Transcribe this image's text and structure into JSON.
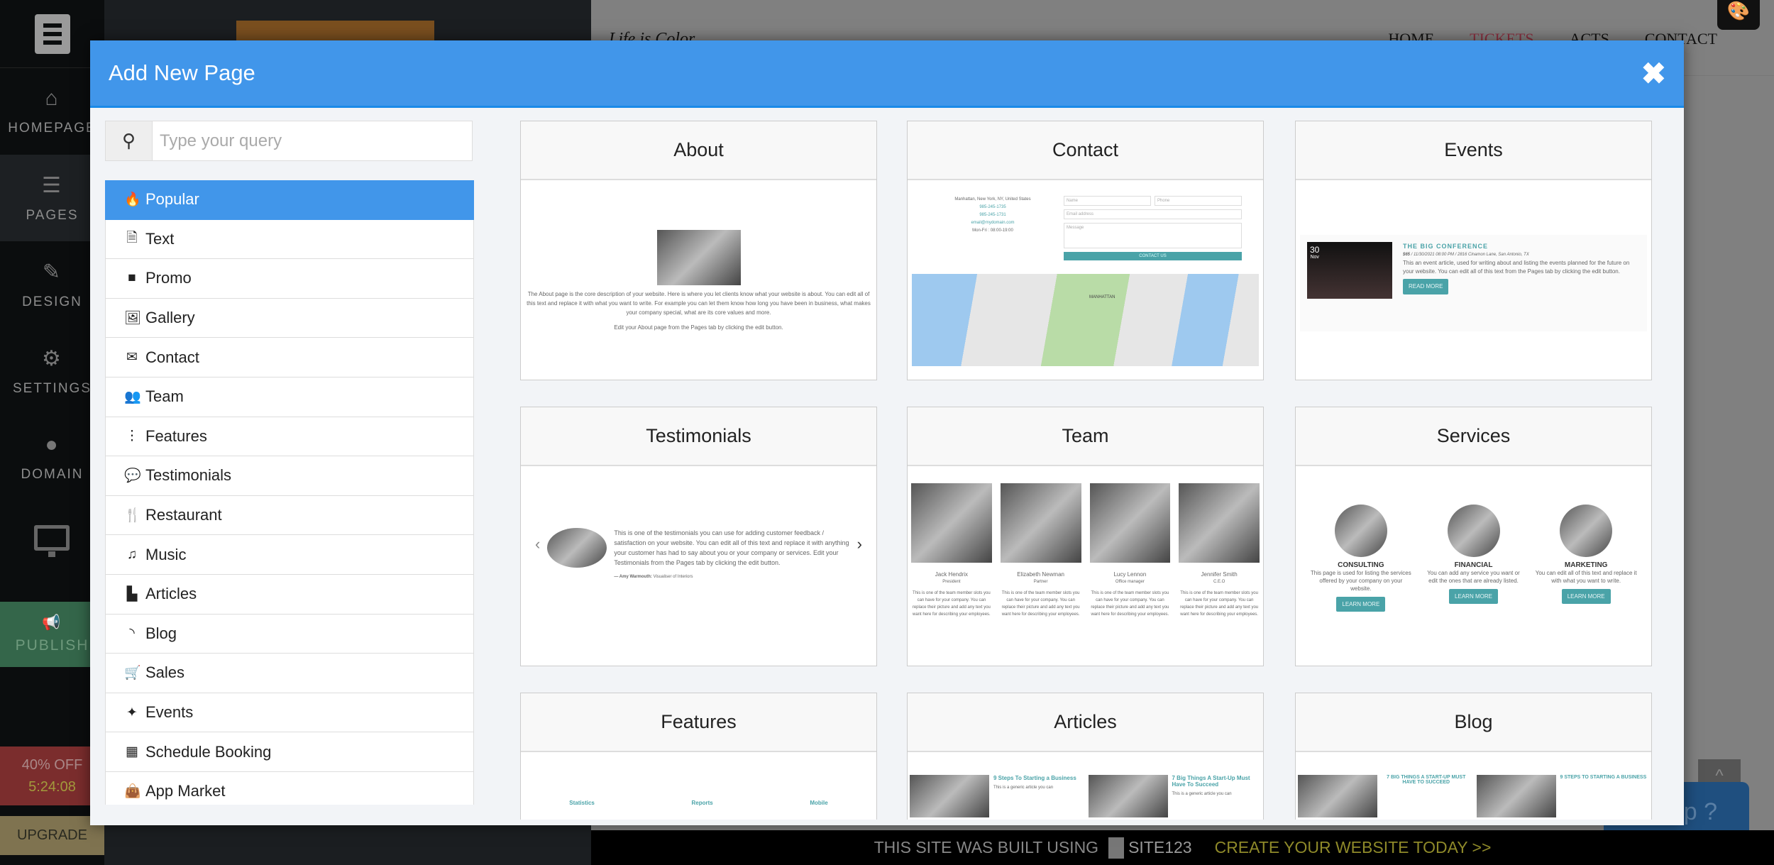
{
  "sidebar": {
    "items": [
      {
        "label": "HOMEPAGE",
        "icon": "home-icon"
      },
      {
        "label": "PAGES",
        "icon": "pages-icon"
      },
      {
        "label": "DESIGN",
        "icon": "brush-icon"
      },
      {
        "label": "SETTINGS",
        "icon": "gear-icon"
      },
      {
        "label": "DOMAIN",
        "icon": "globe-icon"
      }
    ],
    "publish": "PUBLISH",
    "offer": "40% OFF",
    "countdown": "5:24:08",
    "upgrade": "UPGRADE"
  },
  "site": {
    "brand": "Life is Color",
    "menu": [
      "HOME",
      "TICKETS",
      "ACTS",
      "CONTACT"
    ],
    "help": "Help ?",
    "footer": {
      "text": "THIS SITE WAS BUILT USING",
      "logo": "SITE123",
      "cta": "CREATE YOUR WEBSITE TODAY >>"
    }
  },
  "modal": {
    "title": "Add New Page",
    "close": "✖",
    "search_placeholder": "Type your query",
    "categories": [
      {
        "label": "Popular",
        "icon": "fire-icon"
      },
      {
        "label": "Text",
        "icon": "file-text-icon"
      },
      {
        "label": "Promo",
        "icon": "square-icon"
      },
      {
        "label": "Gallery",
        "icon": "image-icon"
      },
      {
        "label": "Contact",
        "icon": "envelope-icon"
      },
      {
        "label": "Team",
        "icon": "users-icon"
      },
      {
        "label": "Features",
        "icon": "ellipsis-icon"
      },
      {
        "label": "Testimonials",
        "icon": "comments-icon"
      },
      {
        "label": "Restaurant",
        "icon": "cutlery-icon"
      },
      {
        "label": "Music",
        "icon": "music-icon"
      },
      {
        "label": "Articles",
        "icon": "file-icon"
      },
      {
        "label": "Blog",
        "icon": "rss-icon"
      },
      {
        "label": "Sales",
        "icon": "cart-icon"
      },
      {
        "label": "Events",
        "icon": "ticket-icon"
      },
      {
        "label": "Schedule Booking",
        "icon": "calendar-icon"
      },
      {
        "label": "App Market",
        "icon": "bag-icon"
      }
    ],
    "cards": [
      "About",
      "Contact",
      "Events",
      "Testimonials",
      "Team",
      "Services",
      "Features",
      "Articles",
      "Blog"
    ]
  },
  "previews": {
    "about": {
      "text": "The About page is the core description of your website. Here is where you let clients know what your website is about. You can edit all of this text and replace it with what you want to write. For example you can let them know how long you have been in business, what makes your company special, what are its core values and more.",
      "edit": "Edit your About page from the Pages tab by clicking the edit button."
    },
    "contact": {
      "address": "Manhattan, New York, NY, United States",
      "phone": "985-245-1735",
      "fax": "985-245-1731",
      "email": "email@mydomain.com",
      "hours": "Mon-Fri : 08:00-19:00",
      "name": "Name",
      "phone_ph": "Phone",
      "email_ph": "Email address",
      "message": "Message",
      "button": "CONTACT US",
      "map_label": "MANHATTAN"
    },
    "events": {
      "day": "30",
      "month": "Nov",
      "title": "THE BIG CONFERENCE",
      "price": "$65",
      "date": "11/30/2021 08:00 PM",
      "place": "2816 Cinamon Lane, San Antonio, TX",
      "text": "This an event article, used for writing about and listing the events planned for the future on your website. You can edit all of this text from the Pages tab by clicking the edit button.",
      "button": "READ MORE"
    },
    "testimonials": {
      "text": "This is one of the testimonials you can use for adding customer feedback / satisfaction on your website. You can edit all of this text and replace it with anything your customer has had to say about you or your company or services. Edit your Testimonials from the Pages tab by clicking the edit button.",
      "author": "— Amy Warmouth:",
      "role": "Visualiser of Interiors"
    },
    "team": {
      "members": [
        {
          "name": "Jack Hendrix",
          "role": "President"
        },
        {
          "name": "Elizabeth Newman",
          "role": "Partner"
        },
        {
          "name": "Lucy Lennon",
          "role": "Office manager"
        },
        {
          "name": "Jennifer Smith",
          "role": "C.E.O"
        }
      ],
      "text": "This is one of the team member slots you can have for your company. You can replace their picture and add any text you want here for describing your employees."
    },
    "services": {
      "items": [
        {
          "title": "CONSULTING",
          "text": "This page is used for listing the services offered by your company on your website."
        },
        {
          "title": "FINANCIAL",
          "text": "You can add any service you want or edit the ones that are already listed."
        },
        {
          "title": "MARKETING",
          "text": "You can edit all of this text and replace it with what you want to write."
        }
      ],
      "button": "LEARN MORE"
    },
    "features": {
      "items": [
        "Statistics",
        "Reports",
        "Mobile"
      ]
    },
    "articles": {
      "items": [
        "9 Steps To Starting a Business",
        "7 Big Things A Start-Up Must Have To Succeed"
      ],
      "text": "This is a generic article you can"
    },
    "blog": {
      "items": [
        "7 BIG THINGS A START-UP MUST HAVE TO SUCCEED",
        "9 STEPS TO STARTING A BUSINESS"
      ]
    }
  },
  "colors": {
    "accent": "#4196ea",
    "teal": "#4aa3a8",
    "publish": "#34664a",
    "offer": "#7b2d2d",
    "upgrade": "#7f7350"
  }
}
